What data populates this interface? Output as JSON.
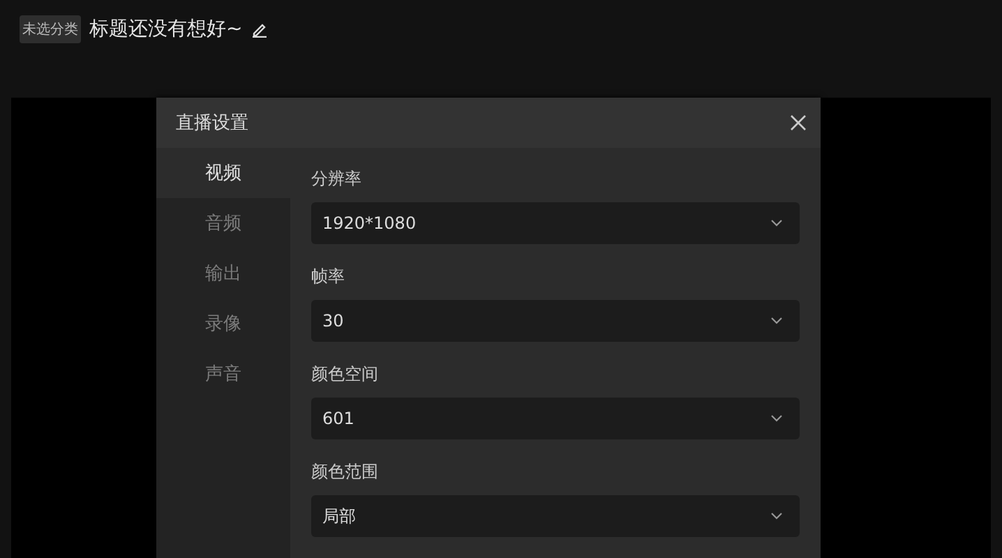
{
  "header": {
    "category_tag": "未选分类",
    "title": "标题还没有想好~"
  },
  "dialog": {
    "title": "直播设置",
    "tabs": [
      {
        "label": "视频",
        "selected": true
      },
      {
        "label": "音频",
        "selected": false
      },
      {
        "label": "输出",
        "selected": false
      },
      {
        "label": "录像",
        "selected": false
      },
      {
        "label": "声音",
        "selected": false
      }
    ],
    "fields": [
      {
        "label": "分辨率",
        "value": "1920*1080"
      },
      {
        "label": "帧率",
        "value": "30"
      },
      {
        "label": "颜色空间",
        "value": "601"
      },
      {
        "label": "颜色范围",
        "value": "局部"
      }
    ]
  }
}
